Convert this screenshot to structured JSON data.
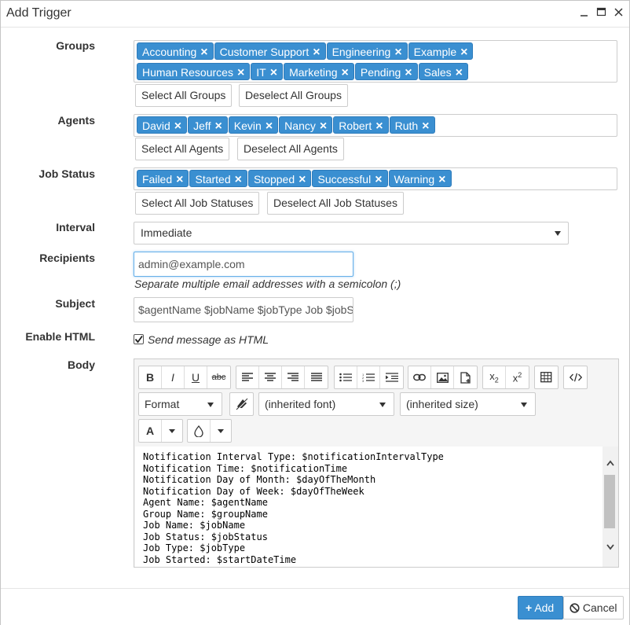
{
  "window": {
    "title": "Add Trigger",
    "controls": [
      "minimize-icon",
      "maximize-icon",
      "close-icon"
    ]
  },
  "groups": {
    "label": "Groups",
    "tags": [
      "Accounting",
      "Customer Support",
      "Engineering",
      "Example",
      "Human Resources",
      "IT",
      "Marketing",
      "Pending",
      "Sales"
    ],
    "select_all": "Select All Groups",
    "deselect_all": "Deselect All Groups"
  },
  "agents": {
    "label": "Agents",
    "tags": [
      "David",
      "Jeff",
      "Kevin",
      "Nancy",
      "Robert",
      "Ruth"
    ],
    "select_all": "Select All Agents",
    "deselect_all": "Deselect All Agents"
  },
  "job_status": {
    "label": "Job Status",
    "tags": [
      "Failed",
      "Started",
      "Stopped",
      "Successful",
      "Warning"
    ],
    "select_all": "Select All Job Statuses",
    "deselect_all": "Deselect All Job Statuses"
  },
  "interval": {
    "label": "Interval",
    "value": "Immediate"
  },
  "recipients": {
    "label": "Recipients",
    "value": "admin@example.com",
    "help": "Separate multiple email addresses with a semicolon (;)"
  },
  "subject": {
    "label": "Subject",
    "value": "$agentName $jobName $jobType Job $jobStatus"
  },
  "enable_html": {
    "label": "Enable HTML",
    "checked": true,
    "checkbox_label": "Send message as HTML"
  },
  "body": {
    "label": "Body",
    "toolbar": {
      "format": "Format",
      "font": "(inherited font)",
      "size": "(inherited size)",
      "bold": "B",
      "italic": "I",
      "underline": "U",
      "strike": "abc",
      "font_color": "A"
    },
    "lines": [
      "Notification Interval Type: $notificationIntervalType",
      "Notification Time: $notificationTime",
      "Notification Day of Month: $dayOfTheMonth",
      "Notification Day of Week: $dayOfTheWeek",
      "Agent Name: $agentName",
      "Group Name: $groupName",
      "Job Name: $jobName",
      "Job Status: $jobStatus",
      "Job Type: $jobType",
      "Job Started: $startDateTime"
    ]
  },
  "footer": {
    "add": "Add",
    "cancel": "Cancel"
  },
  "colors": {
    "accent": "#3a8fd1",
    "tag_border": "#2e7cbc",
    "border": "#cccccc"
  }
}
